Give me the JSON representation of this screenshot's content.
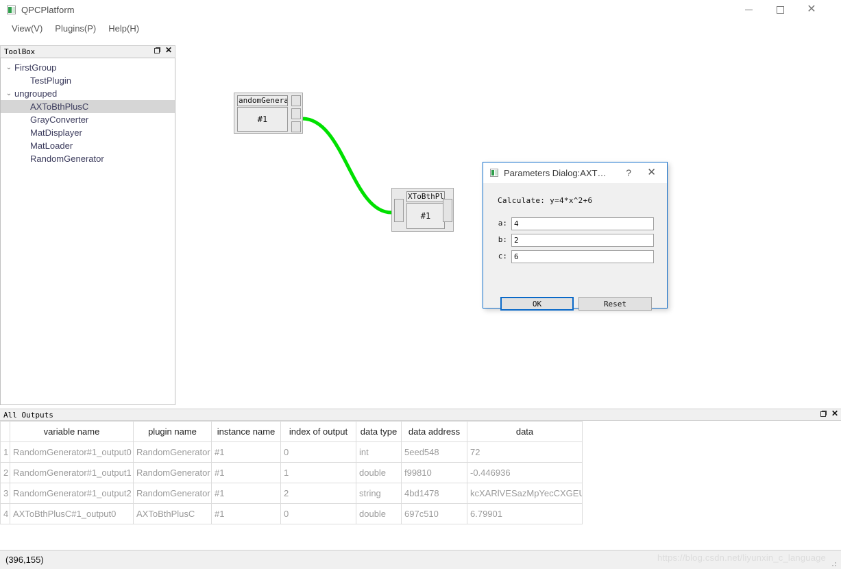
{
  "window": {
    "title": "QPCPlatform",
    "icon": "app-icon",
    "controls": {
      "minimize": "–",
      "maximize": "□",
      "close": "✕"
    }
  },
  "menu": {
    "items": [
      {
        "label": "View(V)"
      },
      {
        "label": "Plugins(P)"
      },
      {
        "label": "Help(H)"
      }
    ]
  },
  "toolbox": {
    "title": "ToolBox",
    "controls": {
      "float": "float-icon",
      "close": "✕"
    },
    "tree": [
      {
        "label": "FirstGroup",
        "type": "group",
        "expanded": true,
        "chevron": "⌄"
      },
      {
        "label": "TestPlugin",
        "type": "leaf",
        "selected": false
      },
      {
        "label": "ungrouped",
        "type": "group",
        "expanded": true,
        "chevron": "⌄"
      },
      {
        "label": "AXToBthPlusC",
        "type": "leaf",
        "selected": true
      },
      {
        "label": "GrayConverter",
        "type": "leaf",
        "selected": false
      },
      {
        "label": "MatDisplayer",
        "type": "leaf",
        "selected": false
      },
      {
        "label": "MatLoader",
        "type": "leaf",
        "selected": false
      },
      {
        "label": "RandomGenerator",
        "type": "leaf",
        "selected": false
      }
    ]
  },
  "canvas": {
    "nodes": [
      {
        "id": "node-random-generator",
        "title": "andomGenerato",
        "instance": "#1",
        "ports_out": 3,
        "ports_in": 0
      },
      {
        "id": "node-axtobthplusc",
        "title": "XToBthPlus",
        "instance": "#1",
        "ports_out": 1,
        "ports_in": 1
      }
    ],
    "connection_color": "#00e000"
  },
  "dialog": {
    "title": "Parameters Dialog:AXT…",
    "help_label": "?",
    "close_label": "✕",
    "formula": "Calculate: y=4*x^2+6",
    "fields": [
      {
        "label": "a:",
        "value": "4"
      },
      {
        "label": "b:",
        "value": "2"
      },
      {
        "label": "c:",
        "value": "6"
      }
    ],
    "buttons": {
      "ok": "OK",
      "reset": "Reset"
    },
    "accent": "#0a69c8"
  },
  "outputs": {
    "title": "All Outputs",
    "controls": {
      "float": "float-icon",
      "close": "✕"
    },
    "columns": [
      "variable name",
      "plugin name",
      "instance name",
      "index of output",
      "data type",
      "data address",
      "data"
    ],
    "rows": [
      {
        "n": "1",
        "variable": "RandomGenerator#1_output0",
        "plugin": "RandomGenerator",
        "instance": "#1",
        "index": "0",
        "type": "int",
        "address": "5eed548",
        "data": "72"
      },
      {
        "n": "2",
        "variable": "RandomGenerator#1_output1",
        "plugin": "RandomGenerator",
        "instance": "#1",
        "index": "1",
        "type": "double",
        "address": "f99810",
        "data": "-0.446936"
      },
      {
        "n": "3",
        "variable": "RandomGenerator#1_output2",
        "plugin": "RandomGenerator",
        "instance": "#1",
        "index": "2",
        "type": "string",
        "address": "4bd1478",
        "data": "kcXARlVESazMpYecCXGEUkhh"
      },
      {
        "n": "4",
        "variable": "AXToBthPlusC#1_output0",
        "plugin": "AXToBthPlusC",
        "instance": "#1",
        "index": "0",
        "type": "double",
        "address": "697c510",
        "data": "6.79901"
      }
    ]
  },
  "statusbar": {
    "coords": "(396,155)",
    "watermark": "https://blog.csdn.net/liyunxin_c_language"
  }
}
